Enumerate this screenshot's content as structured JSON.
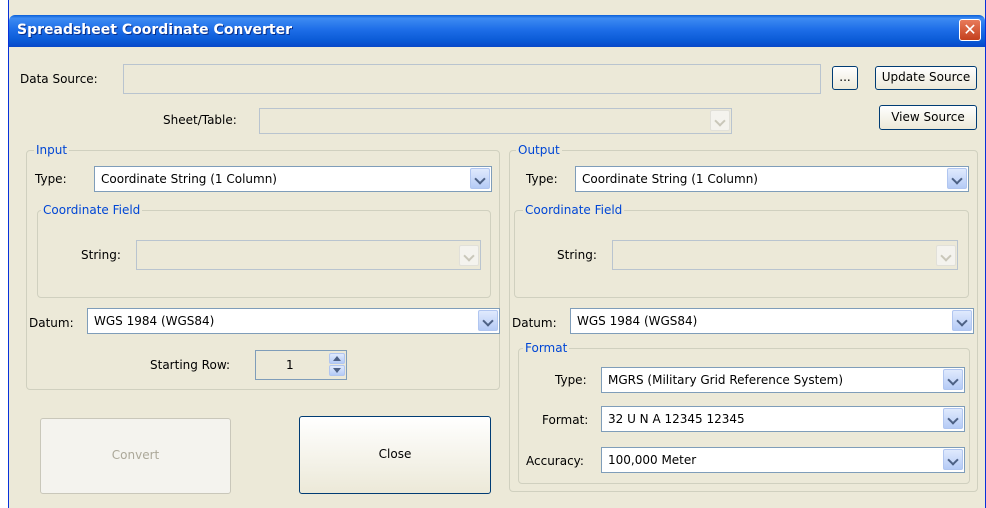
{
  "window": {
    "title": "Spreadsheet Coordinate Converter",
    "close_glyph": "✕"
  },
  "source": {
    "data_source_label": "Data Source:",
    "data_source_value": "",
    "browse_label": "...",
    "update_label": "Update Source",
    "view_label": "View Source",
    "sheet_label": "Sheet/Table:",
    "sheet_value": ""
  },
  "input": {
    "group_title": "Input",
    "type_label": "Type:",
    "type_value": "Coordinate String (1 Column)",
    "coord_group_title": "Coordinate Field",
    "string_label": "String:",
    "string_value": "",
    "datum_label": "Datum:",
    "datum_value": "WGS 1984 (WGS84)",
    "starting_row_label": "Starting Row:",
    "starting_row_value": "1"
  },
  "output": {
    "group_title": "Output",
    "type_label": "Type:",
    "type_value": "Coordinate String (1 Column)",
    "coord_group_title": "Coordinate Field",
    "string_label": "String:",
    "string_value": "",
    "datum_label": "Datum:",
    "datum_value": "WGS 1984 (WGS84)",
    "format_group_title": "Format",
    "format_type_label": "Type:",
    "format_type_value": "MGRS (Military Grid Reference System)",
    "format_label": "Format:",
    "format_value": "32 U N A 12345 12345",
    "accuracy_label": "Accuracy:",
    "accuracy_value": "100,000 Meter"
  },
  "actions": {
    "convert_label": "Convert",
    "close_label": "Close"
  },
  "colors": {
    "group_title": "#0046d5",
    "window_bg": "#ece9d8",
    "titlebar": "#0a5ad6"
  }
}
